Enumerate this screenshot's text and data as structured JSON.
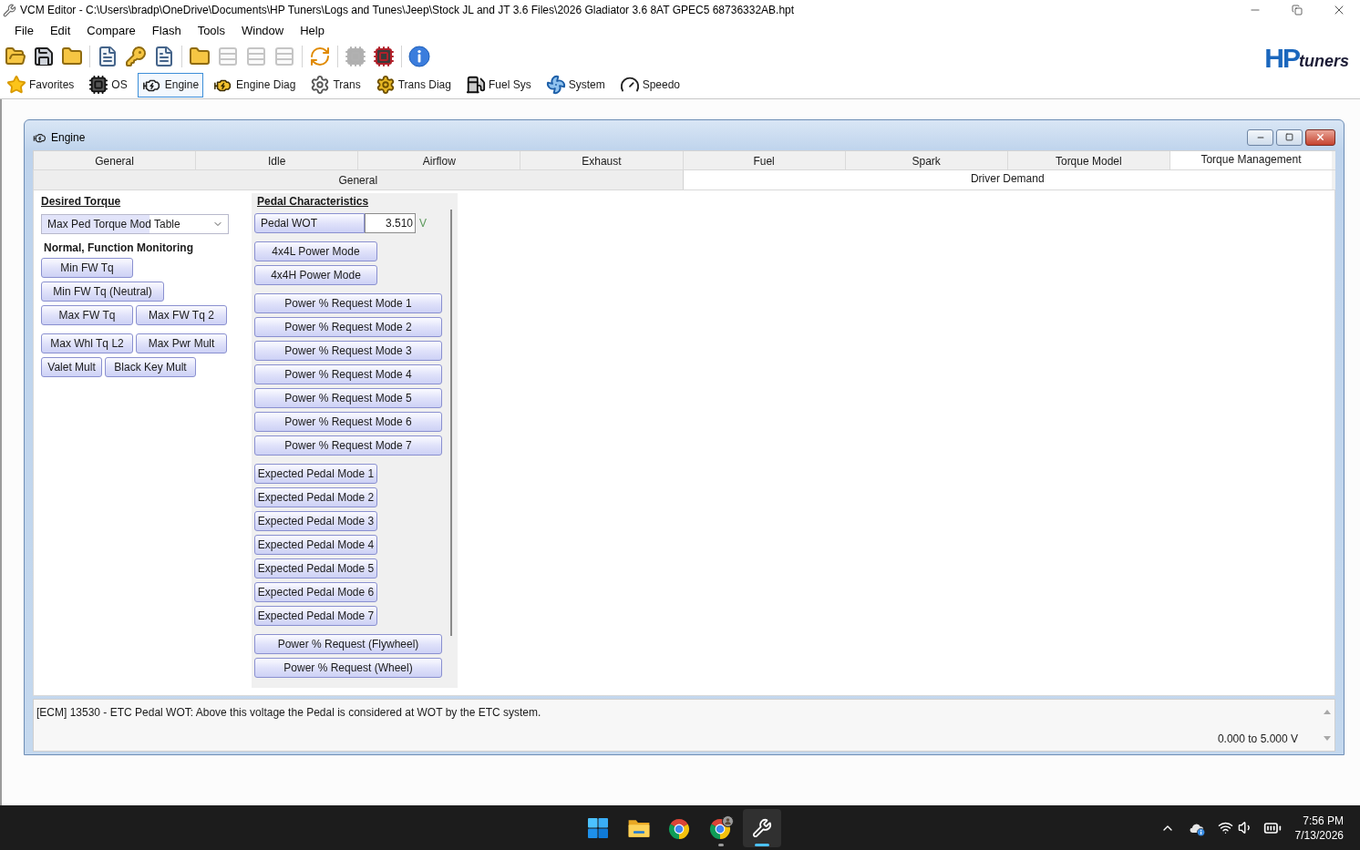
{
  "window": {
    "title": "VCM Editor - C:\\Users\\bradp\\OneDrive\\Documents\\HP Tuners\\Logs and Tunes\\Jeep\\Stock JL and JT 3.6 Files\\2026 Gladiator 3.6 8AT GPEC5 68736332AB.hpt"
  },
  "menu": [
    "File",
    "Edit",
    "Compare",
    "Flash",
    "Tools",
    "Window",
    "Help"
  ],
  "toolbar": [
    {
      "disabled": false
    },
    {
      "disabled": false
    },
    {
      "disabled": false
    },
    {
      "disabled": false
    },
    {
      "disabled": false
    },
    {
      "disabled": false
    },
    {
      "disabled": false
    },
    {
      "disabled": true
    },
    {
      "disabled": true
    },
    {
      "disabled": true
    },
    {
      "disabled": false
    },
    {
      "disabled": true
    },
    {
      "disabled": false
    },
    {
      "disabled": false
    }
  ],
  "logo": {
    "mark": "HP",
    "word": "tuners"
  },
  "module_bar": [
    {
      "label": "Favorites",
      "selected": false
    },
    {
      "label": "OS",
      "selected": false
    },
    {
      "label": "Engine",
      "selected": true
    },
    {
      "label": "Engine Diag",
      "selected": false
    },
    {
      "label": "Trans",
      "selected": false
    },
    {
      "label": "Trans Diag",
      "selected": false
    },
    {
      "label": "Fuel Sys",
      "selected": false
    },
    {
      "label": "System",
      "selected": false
    },
    {
      "label": "Speedo",
      "selected": false
    }
  ],
  "engine_window": {
    "title": "Engine",
    "tabs": [
      {
        "label": "General",
        "selected": false
      },
      {
        "label": "Idle",
        "selected": false
      },
      {
        "label": "Airflow",
        "selected": false
      },
      {
        "label": "Exhaust",
        "selected": false
      },
      {
        "label": "Fuel",
        "selected": false
      },
      {
        "label": "Spark",
        "selected": false
      },
      {
        "label": "Torque Model",
        "selected": false
      },
      {
        "label": "Torque Management",
        "selected": true
      }
    ],
    "subtabs": [
      {
        "label": "General",
        "selected": false
      },
      {
        "label": "Driver Demand",
        "selected": true
      }
    ],
    "desired_torque": {
      "heading": "Desired Torque",
      "dropdown": {
        "value": "Max Ped Torque Mod Table"
      }
    },
    "monitoring": {
      "heading": "Normal, Function Monitoring",
      "rows": [
        [
          "Min FW Tq"
        ],
        [
          "Min FW Tq (Neutral)"
        ],
        [
          "Max FW Tq",
          "Max FW Tq 2"
        ],
        [
          "Max Whl Tq L2",
          "Max Pwr Mult"
        ],
        [
          "Valet Mult",
          "Black Key Mult"
        ]
      ]
    },
    "pedal": {
      "heading": "Pedal Characteristics",
      "field": {
        "label": "Pedal WOT",
        "value": "3.510",
        "unit": "V"
      },
      "groups": [
        [
          "4x4L Power Mode",
          "4x4H Power Mode"
        ],
        [
          "Power % Request Mode 1",
          "Power % Request Mode 2",
          "Power % Request Mode 3",
          "Power % Request Mode 4",
          "Power % Request Mode 5",
          "Power % Request Mode 6",
          "Power % Request Mode 7"
        ],
        [
          "Expected Pedal Mode 1",
          "Expected Pedal Mode 2",
          "Expected Pedal Mode 3",
          "Expected Pedal Mode 4",
          "Expected Pedal Mode 5",
          "Expected Pedal Mode 6",
          "Expected Pedal Mode 7"
        ],
        [
          "Power % Request (Flywheel)",
          "Power % Request (Wheel)"
        ]
      ]
    },
    "description": "[ECM] 13530 - ETC Pedal WOT: Above this voltage the Pedal is considered at WOT by the ETC system.",
    "range": "0.000 to 5.000 V"
  },
  "taskbar": {
    "apps": [
      {
        "running": false,
        "active": false
      },
      {
        "running": false,
        "active": false
      },
      {
        "running": false,
        "active": false
      },
      {
        "running": true,
        "active": false
      },
      {
        "running": true,
        "active": true
      }
    ],
    "time": "7:56 PM",
    "date": "7/13/2026"
  }
}
